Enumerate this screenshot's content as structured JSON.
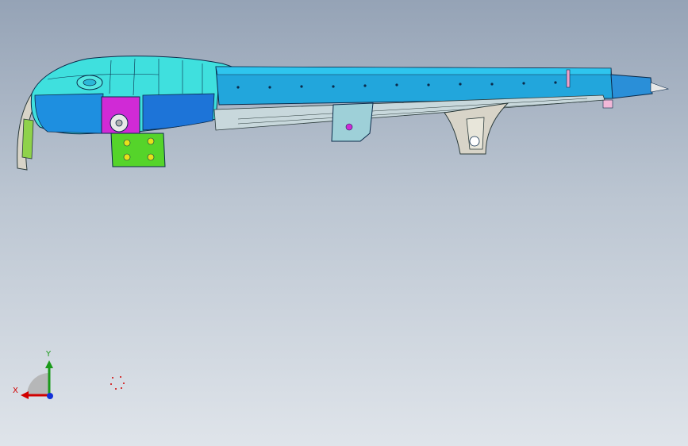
{
  "viewport": {
    "background_top": "#95a3b6",
    "background_bottom": "#dfe4ea"
  },
  "model": {
    "name_icon": "cad-assembly-icon",
    "colors": {
      "rail": "#22a6dc",
      "rail_top": "#2ec5ee",
      "housing": "#3fe0de",
      "housing_dark": "#1e8fe0",
      "motor": "#d02ad6",
      "bracket": "#55d42a",
      "support": "#d8d4c8",
      "edge": "#0a2a4a"
    }
  },
  "triad": {
    "x_label": "X",
    "y_label": "Y",
    "x_color": "#d10000",
    "y_color": "#1a9a1a",
    "z_color": "#1230d8"
  }
}
